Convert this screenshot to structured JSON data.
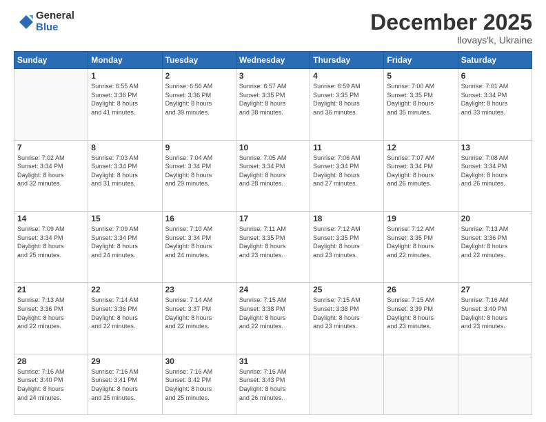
{
  "logo": {
    "general": "General",
    "blue": "Blue"
  },
  "header": {
    "month": "December 2025",
    "location": "Ilovays'k, Ukraine"
  },
  "weekdays": [
    "Sunday",
    "Monday",
    "Tuesday",
    "Wednesday",
    "Thursday",
    "Friday",
    "Saturday"
  ],
  "weeks": [
    [
      {
        "day": "",
        "info": ""
      },
      {
        "day": "1",
        "info": "Sunrise: 6:55 AM\nSunset: 3:36 PM\nDaylight: 8 hours\nand 41 minutes."
      },
      {
        "day": "2",
        "info": "Sunrise: 6:56 AM\nSunset: 3:36 PM\nDaylight: 8 hours\nand 39 minutes."
      },
      {
        "day": "3",
        "info": "Sunrise: 6:57 AM\nSunset: 3:35 PM\nDaylight: 8 hours\nand 38 minutes."
      },
      {
        "day": "4",
        "info": "Sunrise: 6:59 AM\nSunset: 3:35 PM\nDaylight: 8 hours\nand 36 minutes."
      },
      {
        "day": "5",
        "info": "Sunrise: 7:00 AM\nSunset: 3:35 PM\nDaylight: 8 hours\nand 35 minutes."
      },
      {
        "day": "6",
        "info": "Sunrise: 7:01 AM\nSunset: 3:34 PM\nDaylight: 8 hours\nand 33 minutes."
      }
    ],
    [
      {
        "day": "7",
        "info": "Sunrise: 7:02 AM\nSunset: 3:34 PM\nDaylight: 8 hours\nand 32 minutes."
      },
      {
        "day": "8",
        "info": "Sunrise: 7:03 AM\nSunset: 3:34 PM\nDaylight: 8 hours\nand 31 minutes."
      },
      {
        "day": "9",
        "info": "Sunrise: 7:04 AM\nSunset: 3:34 PM\nDaylight: 8 hours\nand 29 minutes."
      },
      {
        "day": "10",
        "info": "Sunrise: 7:05 AM\nSunset: 3:34 PM\nDaylight: 8 hours\nand 28 minutes."
      },
      {
        "day": "11",
        "info": "Sunrise: 7:06 AM\nSunset: 3:34 PM\nDaylight: 8 hours\nand 27 minutes."
      },
      {
        "day": "12",
        "info": "Sunrise: 7:07 AM\nSunset: 3:34 PM\nDaylight: 8 hours\nand 26 minutes."
      },
      {
        "day": "13",
        "info": "Sunrise: 7:08 AM\nSunset: 3:34 PM\nDaylight: 8 hours\nand 26 minutes."
      }
    ],
    [
      {
        "day": "14",
        "info": "Sunrise: 7:09 AM\nSunset: 3:34 PM\nDaylight: 8 hours\nand 25 minutes."
      },
      {
        "day": "15",
        "info": "Sunrise: 7:09 AM\nSunset: 3:34 PM\nDaylight: 8 hours\nand 24 minutes."
      },
      {
        "day": "16",
        "info": "Sunrise: 7:10 AM\nSunset: 3:34 PM\nDaylight: 8 hours\nand 24 minutes."
      },
      {
        "day": "17",
        "info": "Sunrise: 7:11 AM\nSunset: 3:35 PM\nDaylight: 8 hours\nand 23 minutes."
      },
      {
        "day": "18",
        "info": "Sunrise: 7:12 AM\nSunset: 3:35 PM\nDaylight: 8 hours\nand 23 minutes."
      },
      {
        "day": "19",
        "info": "Sunrise: 7:12 AM\nSunset: 3:35 PM\nDaylight: 8 hours\nand 22 minutes."
      },
      {
        "day": "20",
        "info": "Sunrise: 7:13 AM\nSunset: 3:36 PM\nDaylight: 8 hours\nand 22 minutes."
      }
    ],
    [
      {
        "day": "21",
        "info": "Sunrise: 7:13 AM\nSunset: 3:36 PM\nDaylight: 8 hours\nand 22 minutes."
      },
      {
        "day": "22",
        "info": "Sunrise: 7:14 AM\nSunset: 3:36 PM\nDaylight: 8 hours\nand 22 minutes."
      },
      {
        "day": "23",
        "info": "Sunrise: 7:14 AM\nSunset: 3:37 PM\nDaylight: 8 hours\nand 22 minutes."
      },
      {
        "day": "24",
        "info": "Sunrise: 7:15 AM\nSunset: 3:38 PM\nDaylight: 8 hours\nand 22 minutes."
      },
      {
        "day": "25",
        "info": "Sunrise: 7:15 AM\nSunset: 3:38 PM\nDaylight: 8 hours\nand 23 minutes."
      },
      {
        "day": "26",
        "info": "Sunrise: 7:15 AM\nSunset: 3:39 PM\nDaylight: 8 hours\nand 23 minutes."
      },
      {
        "day": "27",
        "info": "Sunrise: 7:16 AM\nSunset: 3:40 PM\nDaylight: 8 hours\nand 23 minutes."
      }
    ],
    [
      {
        "day": "28",
        "info": "Sunrise: 7:16 AM\nSunset: 3:40 PM\nDaylight: 8 hours\nand 24 minutes."
      },
      {
        "day": "29",
        "info": "Sunrise: 7:16 AM\nSunset: 3:41 PM\nDaylight: 8 hours\nand 25 minutes."
      },
      {
        "day": "30",
        "info": "Sunrise: 7:16 AM\nSunset: 3:42 PM\nDaylight: 8 hours\nand 25 minutes."
      },
      {
        "day": "31",
        "info": "Sunrise: 7:16 AM\nSunset: 3:43 PM\nDaylight: 8 hours\nand 26 minutes."
      },
      {
        "day": "",
        "info": ""
      },
      {
        "day": "",
        "info": ""
      },
      {
        "day": "",
        "info": ""
      }
    ]
  ]
}
